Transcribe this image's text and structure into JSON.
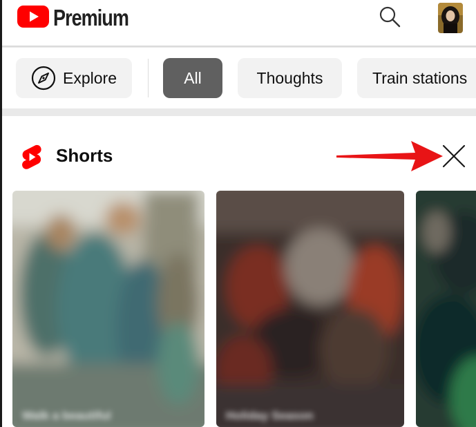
{
  "header": {
    "brand": "Premium",
    "icons": {
      "logo": "youtube-play-logo",
      "search": "search-icon",
      "avatar": "avatar"
    },
    "colors": {
      "brand_red": "#ff0000",
      "text": "#212121"
    }
  },
  "chips": {
    "explore": "Explore",
    "items": [
      "All",
      "Thoughts",
      "Train stations"
    ],
    "selected": "All",
    "colors": {
      "chip_bg": "#f2f2f2",
      "chip_active_bg": "#606060"
    }
  },
  "shorts": {
    "title": "Shorts",
    "icons": {
      "logo": "shorts-logo-icon",
      "close": "close-icon",
      "annotation": "red-arrow"
    },
    "annotation_color": "#e81416",
    "cards": [
      {
        "caption": "Walk a beautiful"
      },
      {
        "caption": "Holiday Season"
      },
      {
        "caption": ""
      }
    ]
  }
}
